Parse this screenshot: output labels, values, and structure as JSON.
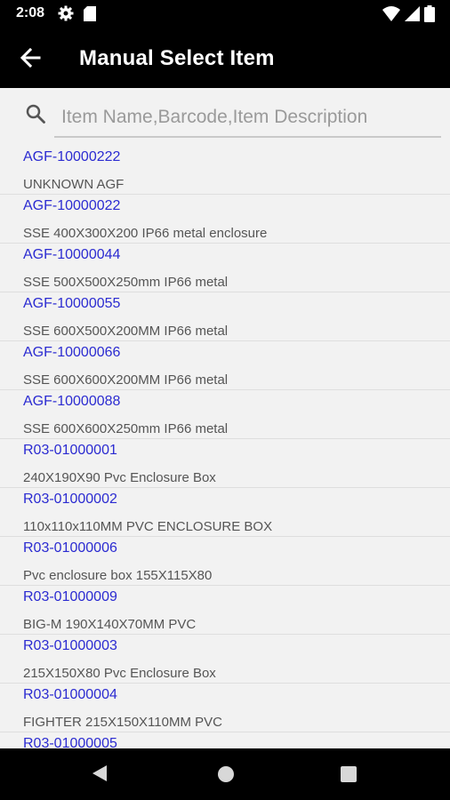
{
  "status_bar": {
    "time": "2:08",
    "icons": [
      "gear-icon",
      "sd-card-icon",
      "wifi-icon",
      "signal-icon",
      "battery-icon"
    ]
  },
  "app_bar": {
    "title": "Manual Select Item",
    "back_icon": "back-arrow-icon"
  },
  "search": {
    "placeholder": "Item Name,Barcode,Item Description",
    "value": ""
  },
  "items": [
    {
      "code": "AGF-10000222",
      "description": "UNKNOWN AGF"
    },
    {
      "code": "AGF-10000022",
      "description": "SSE 400X300X200 IP66 metal enclosure"
    },
    {
      "code": "AGF-10000044",
      "description": "SSE 500X500X250mm IP66 metal"
    },
    {
      "code": "AGF-10000055",
      "description": "SSE 600X500X200MM IP66 metal"
    },
    {
      "code": "AGF-10000066",
      "description": "SSE 600X600X200MM IP66 metal"
    },
    {
      "code": "AGF-10000088",
      "description": "SSE 600X600X250mm IP66 metal"
    },
    {
      "code": "R03-01000001",
      "description": "240X190X90 Pvc Enclosure Box"
    },
    {
      "code": "R03-01000002",
      "description": "110x110x110MM PVC ENCLOSURE BOX"
    },
    {
      "code": "R03-01000006",
      "description": "Pvc enclosure box 155X115X80"
    },
    {
      "code": "R03-01000009",
      "description": "BIG-M 190X140X70MM PVC"
    },
    {
      "code": "R03-01000003",
      "description": "215X150X80 Pvc Enclosure Box"
    },
    {
      "code": "R03-01000004",
      "description": "FIGHTER 215X150X110MM PVC"
    },
    {
      "code": "R03-01000005",
      "description": ""
    }
  ],
  "colors": {
    "accent_code": "#2b2bd1",
    "background": "#f2f2f2",
    "app_bar": "#000000"
  },
  "nav_bar": {
    "icons": [
      "nav-back-icon",
      "nav-home-icon",
      "nav-recents-icon"
    ]
  }
}
